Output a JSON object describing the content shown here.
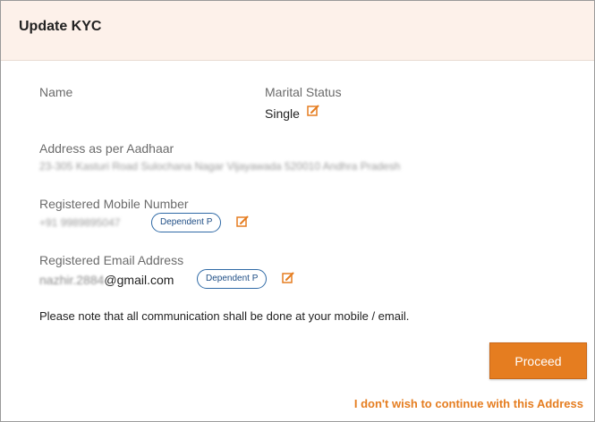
{
  "header": {
    "title": "Update KYC"
  },
  "fields": {
    "name_label": "Name",
    "marital_label": "Marital Status",
    "marital_value": "Single",
    "address_label": "Address as per Aadhaar",
    "address_value": "23-305 Kasturi Road Sulochana Nagar Vijayawada 520010 Andhra Pradesh",
    "mobile_label": "Registered Mobile Number",
    "mobile_value": "+91 9989895047",
    "mobile_badge": "Dependent P",
    "email_label": "Registered Email Address",
    "email_prefix": "nazhir.2884",
    "email_suffix": "@gmail.com",
    "email_badge": "Dependent P"
  },
  "note": "Please note that all communication shall be done at your mobile / email.",
  "actions": {
    "proceed_label": "Proceed",
    "decline_link": "I don't wish to continue with this Address"
  },
  "colors": {
    "accent": "#e57d20",
    "header_bg": "#fdf1ea",
    "badge_border": "#2f6aa6"
  },
  "icons": {
    "edit": "edit-pencil-icon"
  }
}
